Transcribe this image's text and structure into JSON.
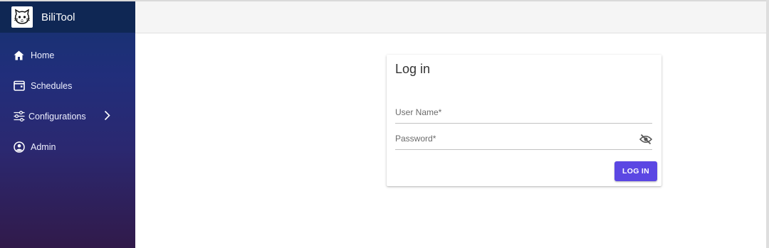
{
  "app": {
    "title": "BiliTool",
    "logo_icon": "cat-logo-icon"
  },
  "sidebar": {
    "items": [
      {
        "label": "Home",
        "icon": "home-icon"
      },
      {
        "label": "Schedules",
        "icon": "calendar-icon"
      },
      {
        "label": "Configurations",
        "icon": "sliders-icon",
        "expand_icon": "chevron-right-icon"
      },
      {
        "label": "Admin",
        "icon": "account-circle-icon"
      }
    ]
  },
  "login": {
    "title": "Log in",
    "username_label": "User Name*",
    "password_label": "Password*",
    "visibility_icon": "eye-off-icon",
    "submit_label": "LOG IN"
  },
  "colors": {
    "sidebar_top": "#14336f",
    "sidebar_bottom": "#311a4a",
    "brand_bar": "#0f2754",
    "primary_button": "#5b47e3",
    "header_bg": "#f5f5f5"
  }
}
